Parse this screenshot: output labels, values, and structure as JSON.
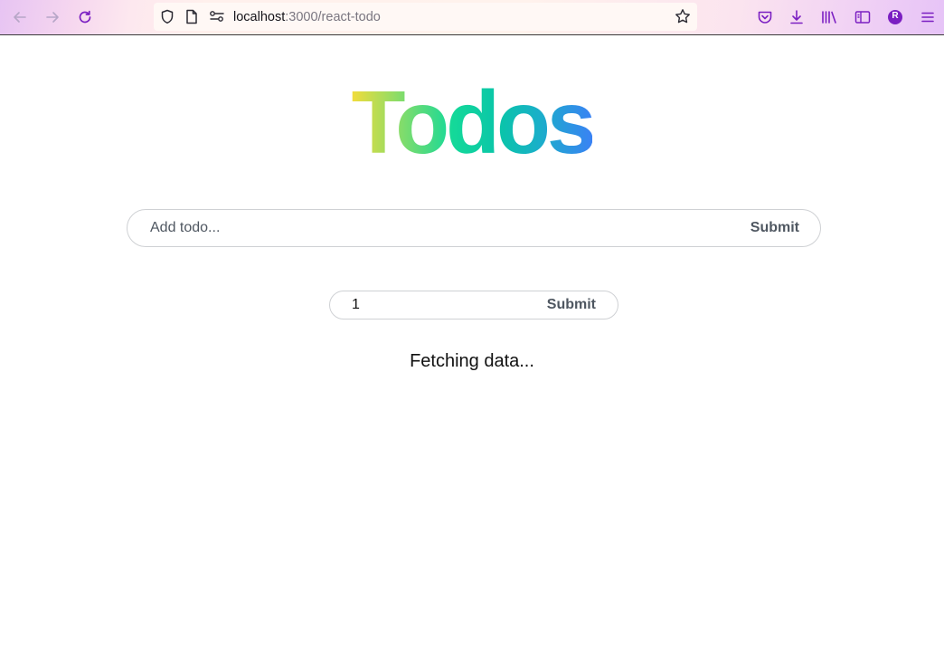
{
  "browser": {
    "url_host": "localhost",
    "url_rest": ":3000/react-todo",
    "profile_initial": "R",
    "accent_color": "#7b1fc2"
  },
  "page": {
    "title": "Todos",
    "add_form": {
      "placeholder": "Add todo...",
      "submit_label": "Submit"
    },
    "page_form": {
      "value": "1",
      "submit_label": "Submit"
    },
    "status_text": "Fetching data..."
  }
}
